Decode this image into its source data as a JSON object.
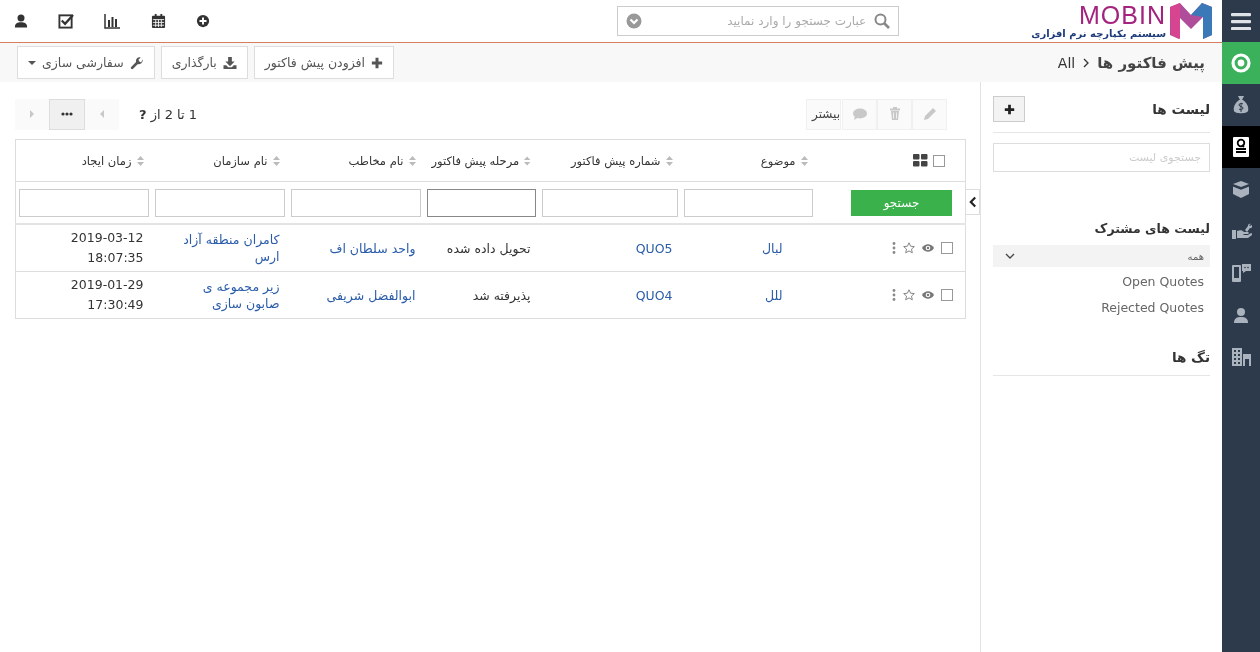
{
  "header": {
    "logo": {
      "name": "MOBIN",
      "tagline": "سیستم یکپارچه نرم افزاری"
    },
    "search": {
      "placeholder": "عبارت جستجو را وارد نمایید"
    }
  },
  "sidebar": {
    "items": [
      {
        "kind": "menu",
        "selected": false
      },
      {
        "kind": "home",
        "selected": false
      },
      {
        "kind": "module",
        "selected": false
      },
      {
        "kind": "module",
        "selected": true
      },
      {
        "kind": "module",
        "selected": false
      },
      {
        "kind": "module",
        "selected": false
      },
      {
        "kind": "module",
        "selected": false
      },
      {
        "kind": "module",
        "selected": false
      },
      {
        "kind": "module",
        "selected": false
      }
    ]
  },
  "breadcrumb": {
    "module": "پیش فاکتور ها",
    "view": "All"
  },
  "actions": [
    {
      "kind": "add",
      "label": "افزودن پیش فاکتور"
    },
    {
      "kind": "import",
      "label": "بارگذاری"
    },
    {
      "kind": "customize",
      "label": "سفارشی سازی"
    }
  ],
  "toolbar": {
    "actions": [
      {
        "kind": "edit",
        "disabled": true
      },
      {
        "kind": "delete",
        "disabled": true
      },
      {
        "kind": "comment",
        "disabled": true
      }
    ],
    "more": "بیشتر",
    "pagination": {
      "summary": "1 تا 2 از **?**",
      "previous_disabled": true,
      "next_disabled": true
    }
  },
  "table": {
    "select_all": false,
    "columns": [
      "موضوع",
      "شماره پیش فاکتور",
      "مرحله پیش فاکتور",
      "نام مخاطب",
      "نام سازمان",
      "زمان ایجاد"
    ],
    "search_button": "جستجو",
    "filters": [
      {
        "focused": false
      },
      {
        "focused": false
      },
      {
        "focused": true
      },
      {
        "focused": false
      },
      {
        "focused": false
      },
      {
        "focused": false
      }
    ],
    "rows": [
      {
        "checked": false,
        "starred": false,
        "subject": "لبال",
        "number": "QUO5",
        "stage": "تحویل داده شده",
        "contact": "واحد سلطان اف",
        "organization": "کامران منطقه آزاد ارس",
        "created": "2019-03-12 18:07:35"
      },
      {
        "checked": false,
        "starred": false,
        "subject": "للل",
        "number": "QUO4",
        "stage": "پذیرفته شد",
        "contact": "ابوالفضل شریفی",
        "organization": "زیر مجموعه ی صابون سازی",
        "created": "2019-01-29 17:30:49"
      }
    ]
  },
  "list_panel": {
    "title": "لیست ها",
    "search": {
      "placeholder": "جستجوی لیست"
    },
    "shared_title": "لیست های مشترک",
    "shared_lists": [
      {
        "label": "همه",
        "kind": "group",
        "selected": true
      },
      {
        "label": "Open Quotes",
        "kind": "list",
        "selected": false
      },
      {
        "label": "Rejected Quotes",
        "kind": "list",
        "selected": false
      }
    ],
    "tags_title": "تگ ها"
  }
}
